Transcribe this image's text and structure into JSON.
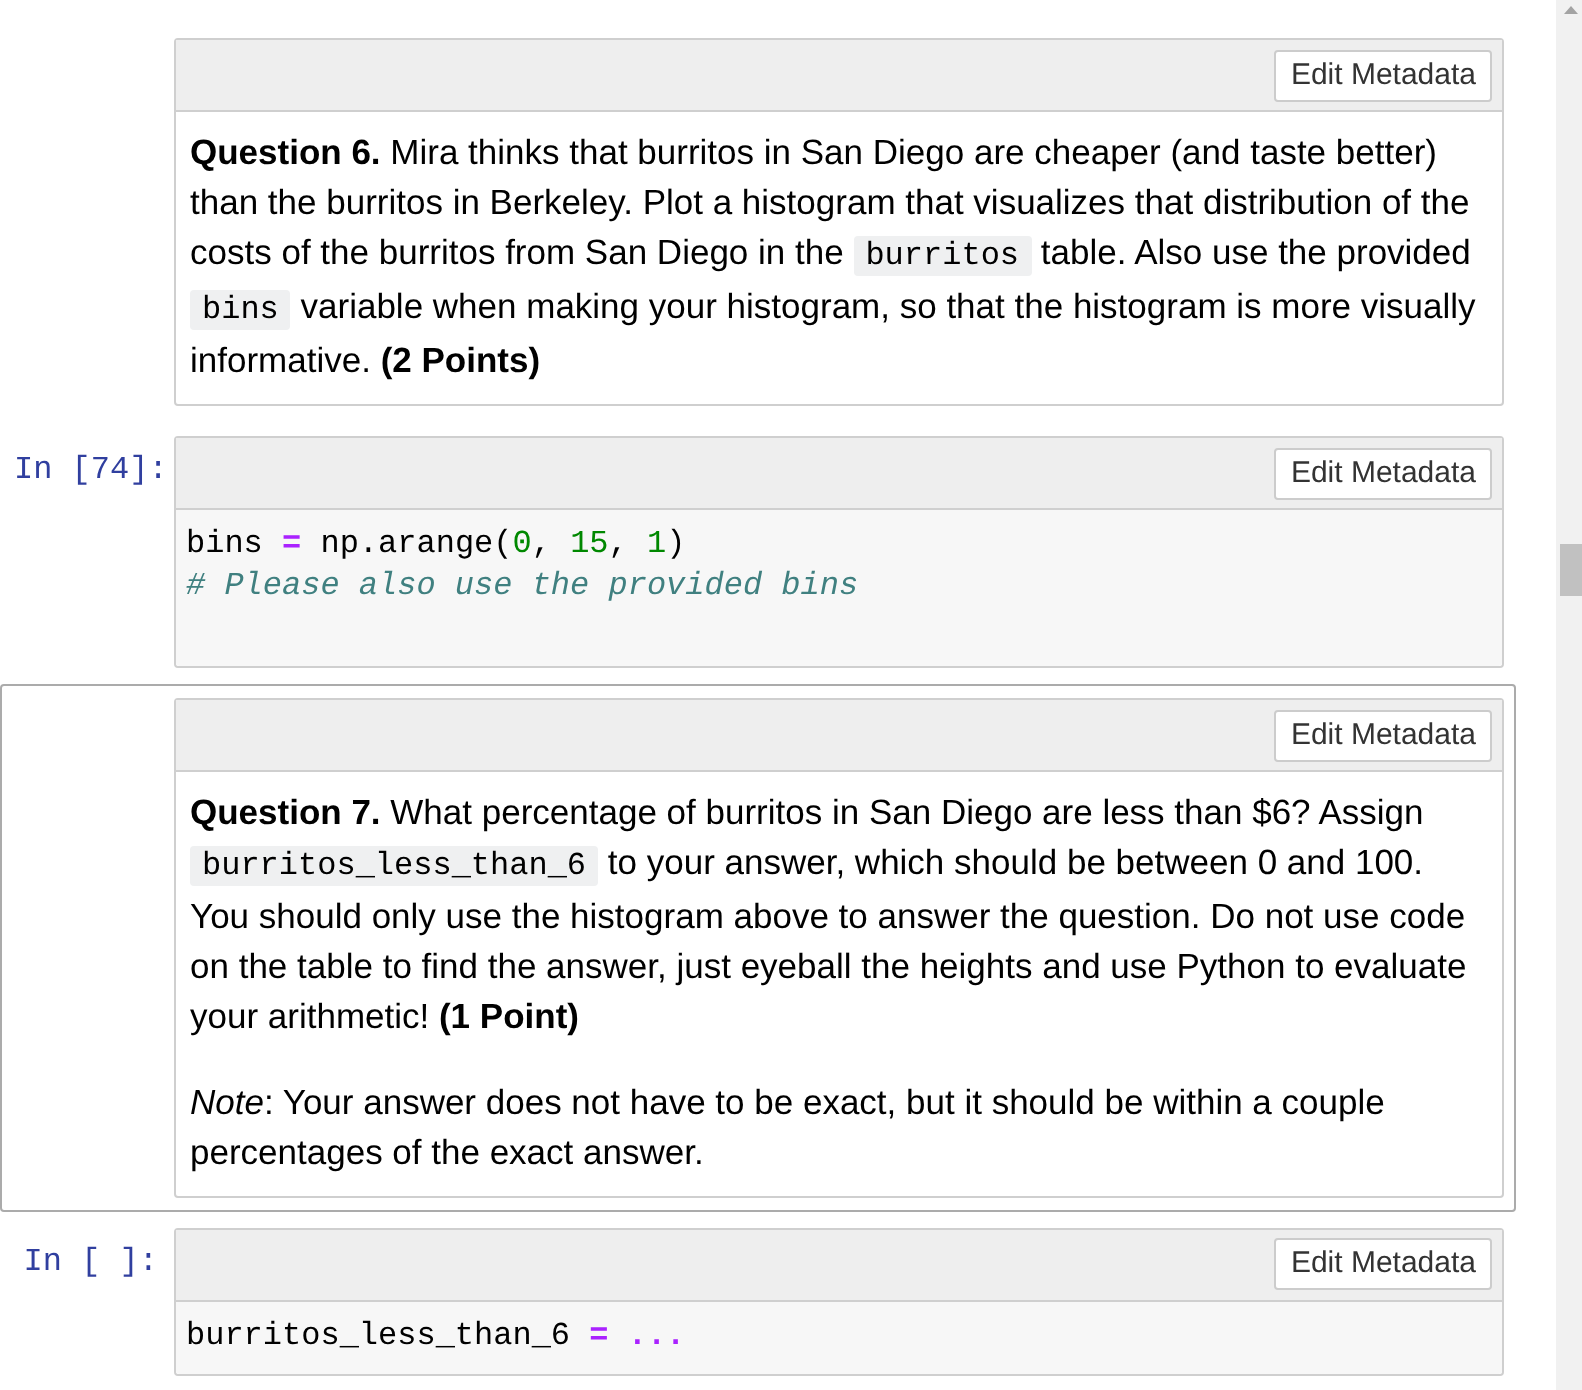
{
  "cells": [
    {
      "kind": "markdown",
      "selected": false,
      "toolbar": {
        "button": "Edit Metadata"
      },
      "paragraphs": [
        {
          "segments": [
            {
              "kind": "text",
              "text": "**Question 6.** Mira thinks that burritos in San Diego are cheaper (and taste better) than the burritos in Berkeley. Plot a histogram that visualizes that distribution of the costs of the burritos from San Diego in the "
            },
            {
              "kind": "code",
              "text": "burritos"
            },
            {
              "kind": "text",
              "text": " table. Also use the provided "
            },
            {
              "kind": "code",
              "text": "bins"
            },
            {
              "kind": "text",
              "text": " variable when making your histogram, so that the histogram is more visually informative. **(2 Points)**"
            }
          ]
        }
      ]
    },
    {
      "kind": "code",
      "selected": false,
      "prompt": "In [74]:",
      "toolbar": {
        "button": "Edit Metadata"
      },
      "lines": [
        {
          "kind": "code",
          "tokens": [
            {
              "kind": "plain",
              "text": "bins "
            },
            {
              "kind": "operator",
              "text": "="
            },
            {
              "kind": "plain",
              "text": " np.arange("
            },
            {
              "kind": "number",
              "text": "0"
            },
            {
              "kind": "plain",
              "text": ", "
            },
            {
              "kind": "number",
              "text": "15"
            },
            {
              "kind": "plain",
              "text": ", "
            },
            {
              "kind": "number",
              "text": "1"
            },
            {
              "kind": "plain",
              "text": ")"
            }
          ]
        },
        {
          "kind": "code",
          "tokens": [
            {
              "kind": "comment",
              "text": "# Please also use the provided bins"
            }
          ]
        },
        {
          "kind": "blank"
        }
      ]
    },
    {
      "kind": "markdown",
      "selected": true,
      "toolbar": {
        "button": "Edit Metadata"
      },
      "paragraphs": [
        {
          "segments": [
            {
              "kind": "text",
              "text": "**Question 7.** What percentage of burritos in San Diego are less than $6? Assign "
            },
            {
              "kind": "code",
              "text": "burritos_less_than_6"
            },
            {
              "kind": "text",
              "text": " to your answer, which should be between 0 and 100. You should only use the histogram above to answer the question. Do not use code on the table to find the answer, just eyeball the heights and use Python to evaluate your arithmetic! **(1 Point)**"
            }
          ]
        },
        {
          "segments": [
            {
              "kind": "text",
              "text": "*Note*: Your answer does not have to be exact, but it should be within a couple percentages of the exact answer."
            }
          ]
        }
      ]
    },
    {
      "kind": "code",
      "selected": false,
      "prompt": "In [ ]:",
      "toolbar": {
        "button": "Edit Metadata"
      },
      "lines": [
        {
          "kind": "code",
          "tokens": [
            {
              "kind": "plain",
              "text": "burritos_less_than_6 "
            },
            {
              "kind": "operator",
              "text": "= ..."
            }
          ]
        }
      ]
    }
  ]
}
